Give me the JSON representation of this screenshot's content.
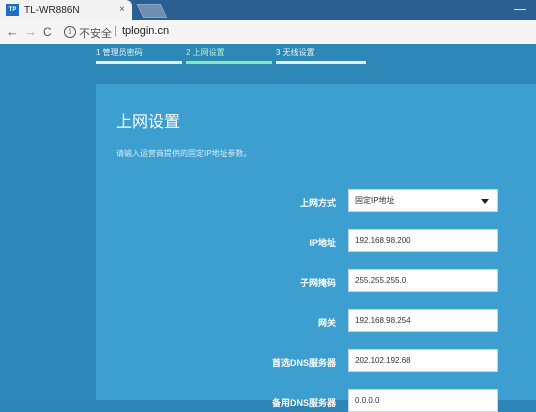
{
  "browser": {
    "tab_title": "TL-WR886N",
    "tab_logo": "TP",
    "close_glyph": "×",
    "security_text": "不安全",
    "separator": "|",
    "url": "tplogin.cn"
  },
  "steps": [
    {
      "label": "1 管理员密码",
      "active": false
    },
    {
      "label": "2 上网设置",
      "active": true
    },
    {
      "label": "3 无线设置",
      "active": false
    }
  ],
  "panel": {
    "title": "上网设置",
    "subtitle": "请输入运营商提供的固定IP地址参数。",
    "fields": [
      {
        "label": "上网方式",
        "value": "固定IP地址",
        "type": "select"
      },
      {
        "label": "IP地址",
        "value": "192.168.98.200",
        "type": "input"
      },
      {
        "label": "子网掩码",
        "value": "255.255.255.0",
        "type": "input"
      },
      {
        "label": "网关",
        "value": "192.168.98.254",
        "type": "input"
      },
      {
        "label": "首选DNS服务器",
        "value": "202.102.192.68",
        "type": "input"
      },
      {
        "label": "备用DNS服务器",
        "value": "0.0.0.0",
        "type": "input"
      }
    ]
  },
  "colors": {
    "page_bg": "#2d87b7",
    "panel_bg": "#3d9fcf",
    "active_step": "#8ee6b0"
  }
}
